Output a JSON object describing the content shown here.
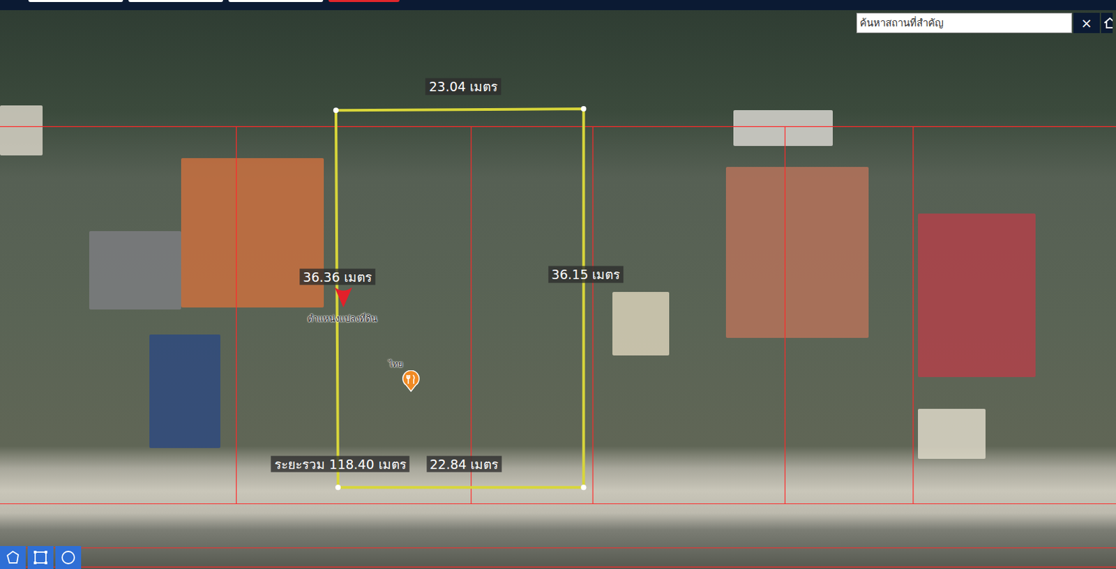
{
  "top_bar": {
    "buttons": [
      {
        "color": "#ffffff"
      },
      {
        "color": "#ffffff"
      },
      {
        "color": "#ffffff"
      },
      {
        "color": "#e0262b"
      }
    ]
  },
  "search": {
    "placeholder": "ค้นหาสถานที่สำคัญ",
    "clear": "×"
  },
  "measurement": {
    "segments": [
      {
        "label": "23.04 เมตร",
        "side": "top"
      },
      {
        "label": "36.36 เมตร",
        "side": "left"
      },
      {
        "label": "36.15 เมตร",
        "side": "right"
      },
      {
        "label": "22.84 เมตร",
        "side": "bottom"
      }
    ],
    "total": "ระยะรวม 118.40 เมตร"
  },
  "markers": [
    {
      "kind": "parcel",
      "label": "ตำแหน่งแปลงที่ดิน"
    },
    {
      "kind": "restaurant",
      "label": "ไทย"
    }
  ],
  "tools": [
    {
      "kind": "polygon"
    },
    {
      "kind": "rectangle"
    },
    {
      "kind": "circle"
    }
  ]
}
